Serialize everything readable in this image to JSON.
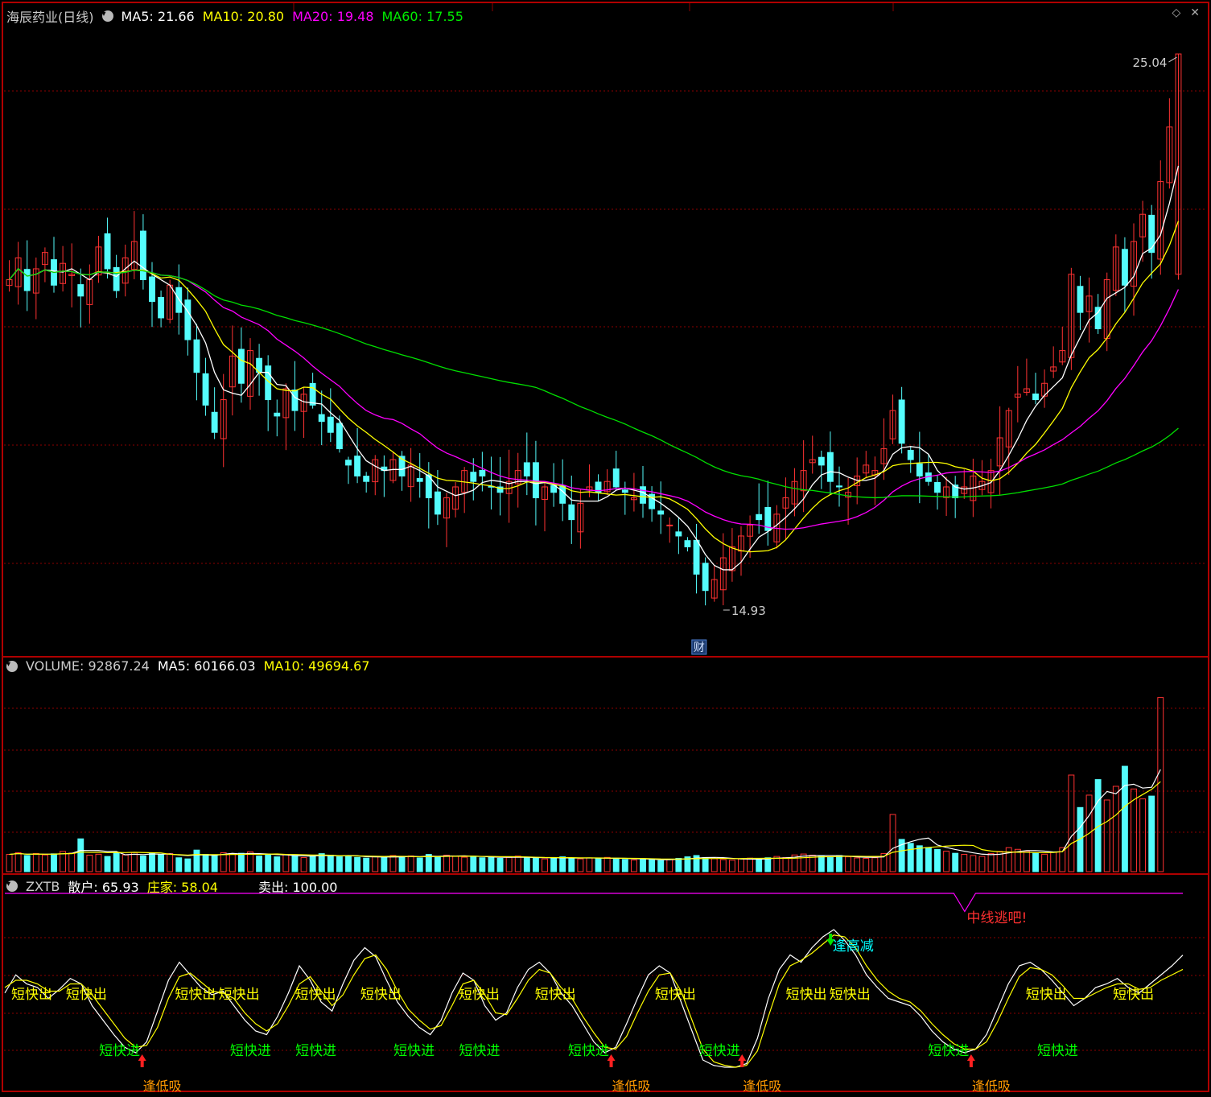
{
  "price_header": {
    "title": "海辰药业(日线)",
    "ma5": "MA5: 21.66",
    "ma10": "MA10: 20.80",
    "ma20": "MA20: 19.48",
    "ma60": "MA60: 17.55"
  },
  "volume_header": {
    "volume": "VOLUME: 92867.24",
    "ma5": "MA5: 60166.03",
    "ma10": "MA10: 49694.67"
  },
  "indicator_header": {
    "name": "ZXTB",
    "retail": "散户: 65.93",
    "dealer": "庄家: 58.04",
    "sell": "卖出: 100.00"
  },
  "colors": {
    "up": "#ff3232",
    "down": "#54fcfc",
    "ma5": "#ffffff",
    "ma10": "#ffff00",
    "ma20": "#ff00ff",
    "ma60": "#00e000",
    "grid": "#8b0000",
    "frame": "#b00000"
  },
  "chart_data": [
    {
      "type": "candlestick",
      "title": "海辰药业(日线)",
      "ylim": [
        14.0,
        26.0
      ],
      "high_label": "25.04",
      "low_label": "14.93",
      "event_marker": "财",
      "closes": [
        20.9,
        21.3,
        20.7,
        21.1,
        21.4,
        20.8,
        21.2,
        21.0,
        20.6,
        20.9,
        21.5,
        21.1,
        20.7,
        21.3,
        21.6,
        20.9,
        20.5,
        20.2,
        20.8,
        20.3,
        19.8,
        19.2,
        18.6,
        18.1,
        18.7,
        19.5,
        19.0,
        19.6,
        19.2,
        18.7,
        18.4,
        18.9,
        18.5,
        18.8,
        18.6,
        18.3,
        18.1,
        17.8,
        17.5,
        17.3,
        17.2,
        17.6,
        17.4,
        17.6,
        17.3,
        17.5,
        17.2,
        16.9,
        16.6,
        16.9,
        17.1,
        17.4,
        17.2,
        17.3,
        17.1,
        17.0,
        17.2,
        17.4,
        17.3,
        16.9,
        17.1,
        17.0,
        16.8,
        16.5,
        16.8,
        17.1,
        17.0,
        17.2,
        17.1,
        17.0,
        16.9,
        16.8,
        16.7,
        16.6,
        16.4,
        16.2,
        16.0,
        15.5,
        15.2,
        15.4,
        15.8,
        16.0,
        16.2,
        16.4,
        16.5,
        16.3,
        16.6,
        16.9,
        17.2,
        17.4,
        17.6,
        17.5,
        17.2,
        17.1,
        17.0,
        17.3,
        17.5,
        17.4,
        17.8,
        18.5,
        17.9,
        17.6,
        17.3,
        17.2,
        17.0,
        17.1,
        16.9,
        17.1,
        17.3,
        17.2,
        17.4,
        18.0,
        18.5,
        18.8,
        18.9,
        18.7,
        19.0,
        19.3,
        19.6,
        21.0,
        20.3,
        20.6,
        20.0,
        20.9,
        21.5,
        20.8,
        21.6,
        22.1,
        21.4,
        22.7,
        23.7,
        25.04
      ],
      "ma_legend": [
        "MA5",
        "MA10",
        "MA20",
        "MA60"
      ]
    },
    {
      "type": "bar",
      "title": "VOLUME",
      "ylim": [
        0,
        100000
      ],
      "values": [
        9200,
        10100,
        8600,
        9700,
        8900,
        9500,
        10800,
        9900,
        17500,
        8800,
        9300,
        8100,
        9900,
        8900,
        10200,
        8400,
        9800,
        9200,
        9600,
        7400,
        6800,
        11500,
        9200,
        8600,
        10100,
        9400,
        9800,
        10600,
        8300,
        8900,
        7900,
        9100,
        8700,
        7500,
        8200,
        9600,
        8800,
        7900,
        8500,
        7600,
        7200,
        8100,
        7700,
        8600,
        7900,
        8400,
        7300,
        9200,
        8100,
        8800,
        8300,
        7700,
        8200,
        7400,
        7900,
        7100,
        7600,
        8300,
        7400,
        7100,
        6800,
        7400,
        7900,
        7200,
        6800,
        7300,
        6900,
        7600,
        7100,
        6500,
        6200,
        6900,
        6400,
        5900,
        6600,
        7100,
        7900,
        8600,
        7500,
        6900,
        6400,
        6100,
        6800,
        7200,
        6600,
        7400,
        8100,
        7500,
        8900,
        9400,
        8800,
        8200,
        7500,
        8600,
        7900,
        7300,
        7100,
        7400,
        9700,
        30500,
        17200,
        15100,
        13800,
        12900,
        11800,
        10900,
        9800,
        9200,
        8600,
        8100,
        9700,
        10800,
        12800,
        11900,
        10900,
        9800,
        9300,
        10500,
        12800,
        51500,
        34200,
        40800,
        49100,
        38200,
        45500,
        56200,
        44100,
        38800,
        40300,
        92867
      ]
    },
    {
      "type": "line",
      "title": "ZXTB",
      "ylim": [
        0,
        100
      ],
      "series": [
        {
          "name": "散户",
          "values": [
            45,
            55,
            50,
            48,
            42,
            47,
            53,
            50,
            38,
            30,
            22,
            15,
            12,
            18,
            35,
            52,
            62,
            55,
            48,
            44,
            46,
            38,
            30,
            24,
            22,
            32,
            45,
            60,
            52,
            40,
            35,
            50,
            63,
            70,
            65,
            52,
            40,
            32,
            26,
            22,
            30,
            45,
            56,
            52,
            38,
            30,
            34,
            48,
            58,
            62,
            56,
            45,
            38,
            28,
            18,
            12,
            15,
            28,
            42,
            55,
            60,
            56,
            40,
            24,
            8,
            5,
            4,
            4,
            6,
            20,
            42,
            58,
            66,
            62,
            70,
            76,
            80,
            74,
            66,
            55,
            48,
            42,
            40,
            38,
            32,
            24,
            18,
            14,
            12,
            14,
            22,
            36,
            50,
            60,
            62,
            58,
            52,
            45,
            38,
            42,
            48,
            50,
            53,
            48,
            45,
            50,
            55,
            60,
            65.93
          ]
        },
        {
          "name": "庄家",
          "values": [
            48,
            52,
            52,
            50,
            46,
            46,
            50,
            50,
            44,
            36,
            28,
            20,
            15,
            16,
            26,
            42,
            54,
            56,
            51,
            46,
            45,
            42,
            34,
            28,
            24,
            28,
            38,
            50,
            54,
            46,
            38,
            44,
            55,
            64,
            66,
            58,
            46,
            36,
            30,
            25,
            27,
            38,
            50,
            52,
            44,
            34,
            33,
            42,
            52,
            58,
            56,
            48,
            42,
            32,
            23,
            15,
            14,
            21,
            34,
            46,
            55,
            56,
            46,
            30,
            14,
            7,
            5,
            4,
            5,
            13,
            32,
            50,
            60,
            63,
            67,
            72,
            77,
            76,
            70,
            60,
            52,
            46,
            42,
            40,
            35,
            28,
            22,
            17,
            14,
            14,
            18,
            29,
            42,
            54,
            59,
            58,
            55,
            49,
            42,
            42,
            45,
            48,
            50,
            50,
            47,
            48,
            52,
            55,
            58.04
          ]
        },
        {
          "name": "卖出",
          "values": [
            100,
            100,
            100,
            100,
            100,
            100,
            100,
            100,
            100,
            100,
            100,
            100,
            100,
            100,
            100,
            100,
            100,
            100,
            100,
            100,
            100,
            100,
            100,
            100,
            100,
            100,
            100,
            100,
            100,
            100,
            100,
            100,
            100,
            100,
            100,
            100,
            100,
            100,
            100,
            100,
            100,
            100,
            100,
            100,
            100,
            100,
            100,
            100,
            100,
            100,
            100,
            100,
            100,
            100,
            100,
            100,
            100,
            100,
            100,
            100,
            100,
            100,
            100,
            100,
            100,
            100,
            100,
            100,
            100,
            100,
            100,
            100,
            100,
            100,
            100,
            100,
            100,
            100,
            100,
            100,
            100,
            100,
            100,
            100,
            100,
            100,
            100,
            100,
            100,
            100,
            100,
            100,
            100,
            100,
            100,
            100,
            100,
            100,
            100,
            100,
            100,
            100,
            100,
            100,
            100,
            100,
            100,
            100,
            100
          ]
        }
      ],
      "annotations": {
        "sell_short": "短快出",
        "buy_short": "短快进",
        "buy_low": "逢低吸",
        "reduce_high": "逢高减",
        "exit_mid": "中线逃吧!"
      }
    }
  ]
}
